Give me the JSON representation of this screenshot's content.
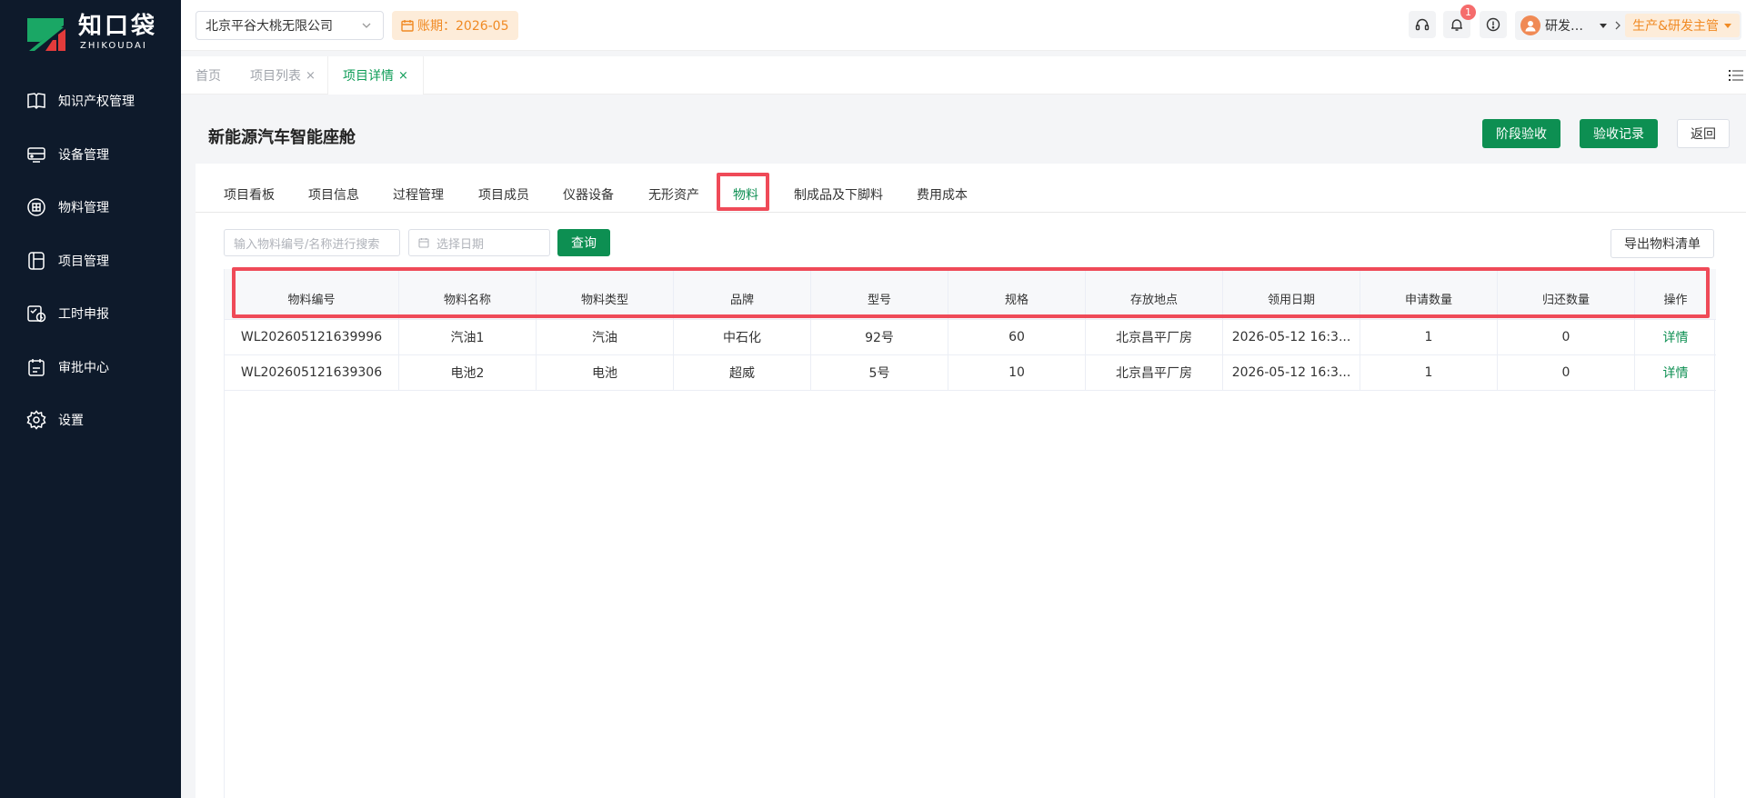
{
  "brand": {
    "name_cn": "知口袋",
    "name_en": "ZHIKOUDAI"
  },
  "sidebar": {
    "items": [
      {
        "label": "知识产权管理",
        "icon": "book-icon"
      },
      {
        "label": "设备管理",
        "icon": "device-icon"
      },
      {
        "label": "物料管理",
        "icon": "material-icon"
      },
      {
        "label": "项目管理",
        "icon": "project-icon"
      },
      {
        "label": "工时申报",
        "icon": "timesheet-icon"
      },
      {
        "label": "审批中心",
        "icon": "approval-icon"
      },
      {
        "label": "设置",
        "icon": "gear-icon"
      }
    ]
  },
  "header": {
    "company": "北京平谷大桃无限公司",
    "period": "账期：2026-05",
    "notification_count": "1",
    "user_name": "研发…",
    "role": "生产&研发主管"
  },
  "page_tabs": [
    {
      "label": "首页"
    },
    {
      "label": "项目列表",
      "close": "×"
    },
    {
      "label": "项目详情",
      "close": "×"
    }
  ],
  "page": {
    "title": "新能源汽车智能座舱",
    "btn_stage_accept": "阶段验收",
    "btn_accept_record": "验收记录",
    "btn_back": "返回"
  },
  "section_tabs": [
    "项目看板",
    "项目信息",
    "过程管理",
    "项目成员",
    "仪器设备",
    "无形资产",
    "物料",
    "制成品及下脚料",
    "费用成本"
  ],
  "filters": {
    "search_placeholder": "输入物料编号/名称进行搜索",
    "date_placeholder": "选择日期",
    "query_label": "查询",
    "export_label": "导出物料清单"
  },
  "table": {
    "columns": [
      "物料编号",
      "物料名称",
      "物料类型",
      "品牌",
      "型号",
      "规格",
      "存放地点",
      "领用日期",
      "申请数量",
      "归还数量",
      "操作"
    ],
    "rows": [
      [
        "WL202605121639996",
        "汽油1",
        "汽油",
        "中石化",
        "92号",
        "60",
        "北京昌平厂房",
        "2026-05-12 16:3...",
        "1",
        "0",
        "详情"
      ],
      [
        "WL202605121639306",
        "电池2",
        "电池",
        "超威",
        "5号",
        "10",
        "北京昌平厂房",
        "2026-05-12 16:3...",
        "1",
        "0",
        "详情"
      ]
    ]
  },
  "colors": {
    "sidebar_bg": "#0e1a2b",
    "brand_green": "#0d8f52",
    "highlight_red": "#ef4a58",
    "accent_orange": "#f08a24"
  }
}
